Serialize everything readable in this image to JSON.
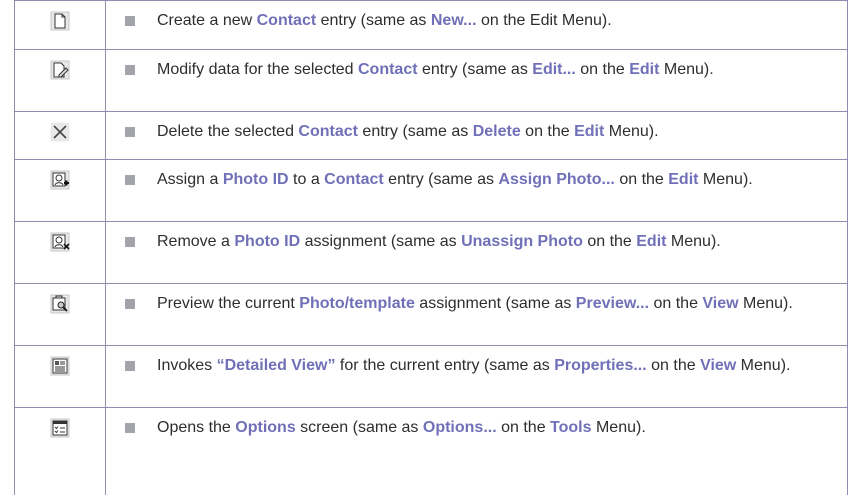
{
  "rows": [
    {
      "icon": "new-document-icon",
      "parts": [
        "Create a new ",
        "Contact",
        " entry (same as ",
        "New...",
        " on the Edit Menu)."
      ]
    },
    {
      "icon": "edit-document-icon",
      "parts": [
        "Modify data for the selected ",
        "Contact",
        " entry (same as ",
        "Edit...",
        " on the ",
        "Edit",
        " Menu)."
      ]
    },
    {
      "icon": "delete-x-icon",
      "parts": [
        "Delete the selected ",
        "Contact",
        " entry (same as ",
        "Delete",
        " on the ",
        "Edit",
        " Menu)."
      ]
    },
    {
      "icon": "assign-photo-icon",
      "parts": [
        "Assign a ",
        "Photo ID",
        " to a ",
        "Contact",
        " entry (same as ",
        "Assign Photo...",
        " on the ",
        "Edit",
        " Menu)."
      ]
    },
    {
      "icon": "unassign-photo-icon",
      "parts": [
        "Remove a ",
        "Photo ID",
        " assignment (same as ",
        "Unassign Photo",
        " on the ",
        "Edit",
        " Menu)."
      ]
    },
    {
      "icon": "preview-icon",
      "parts": [
        "Preview the current ",
        "Photo/template",
        " assignment (same as ",
        "Preview...",
        " on the ",
        "View",
        " Menu)."
      ]
    },
    {
      "icon": "properties-icon",
      "parts": [
        "Invokes ",
        "“Detailed View”",
        " for the current entry (same as ",
        "Properties...",
        " on the ",
        "View",
        " Menu)."
      ]
    },
    {
      "icon": "options-icon",
      "parts": [
        "Opens the ",
        "Options",
        " screen (same as ",
        "Options...",
        " on the ",
        "Tools",
        " Menu)."
      ]
    }
  ]
}
